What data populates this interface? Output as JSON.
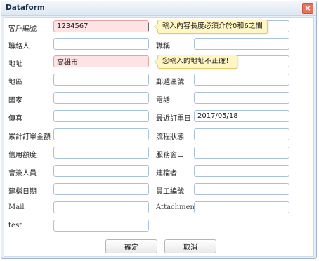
{
  "window": {
    "title": "Dataform",
    "close_glyph": "×"
  },
  "labels": {
    "customer_no": "客戶編號",
    "contact": "聯絡人",
    "job_title": "職稱",
    "address": "地址",
    "region": "地區",
    "postal_code": "郵遞區號",
    "country": "國家",
    "phone": "電話",
    "fax": "傳真",
    "last_order_date": "最近訂單日",
    "total_order_amount": "累計訂單金額",
    "process_status": "流程狀態",
    "credit_limit": "信用額度",
    "service_window": "服務窗口",
    "member": "會簽人員",
    "creator": "建檔者",
    "created_date": "建檔日期",
    "employee_no": "員工編號",
    "mail": "Mail",
    "attachment": "Attachment",
    "test": "test"
  },
  "values": {
    "customer_no": "1234567",
    "address": "高雄市",
    "last_order_date": "2017/05/18"
  },
  "tooltips": {
    "customer_no": "輸入內容長度必須介於0和6之間",
    "address": "您輸入的地址不正確！"
  },
  "buttons": {
    "ok": "確定",
    "cancel": "取消"
  }
}
